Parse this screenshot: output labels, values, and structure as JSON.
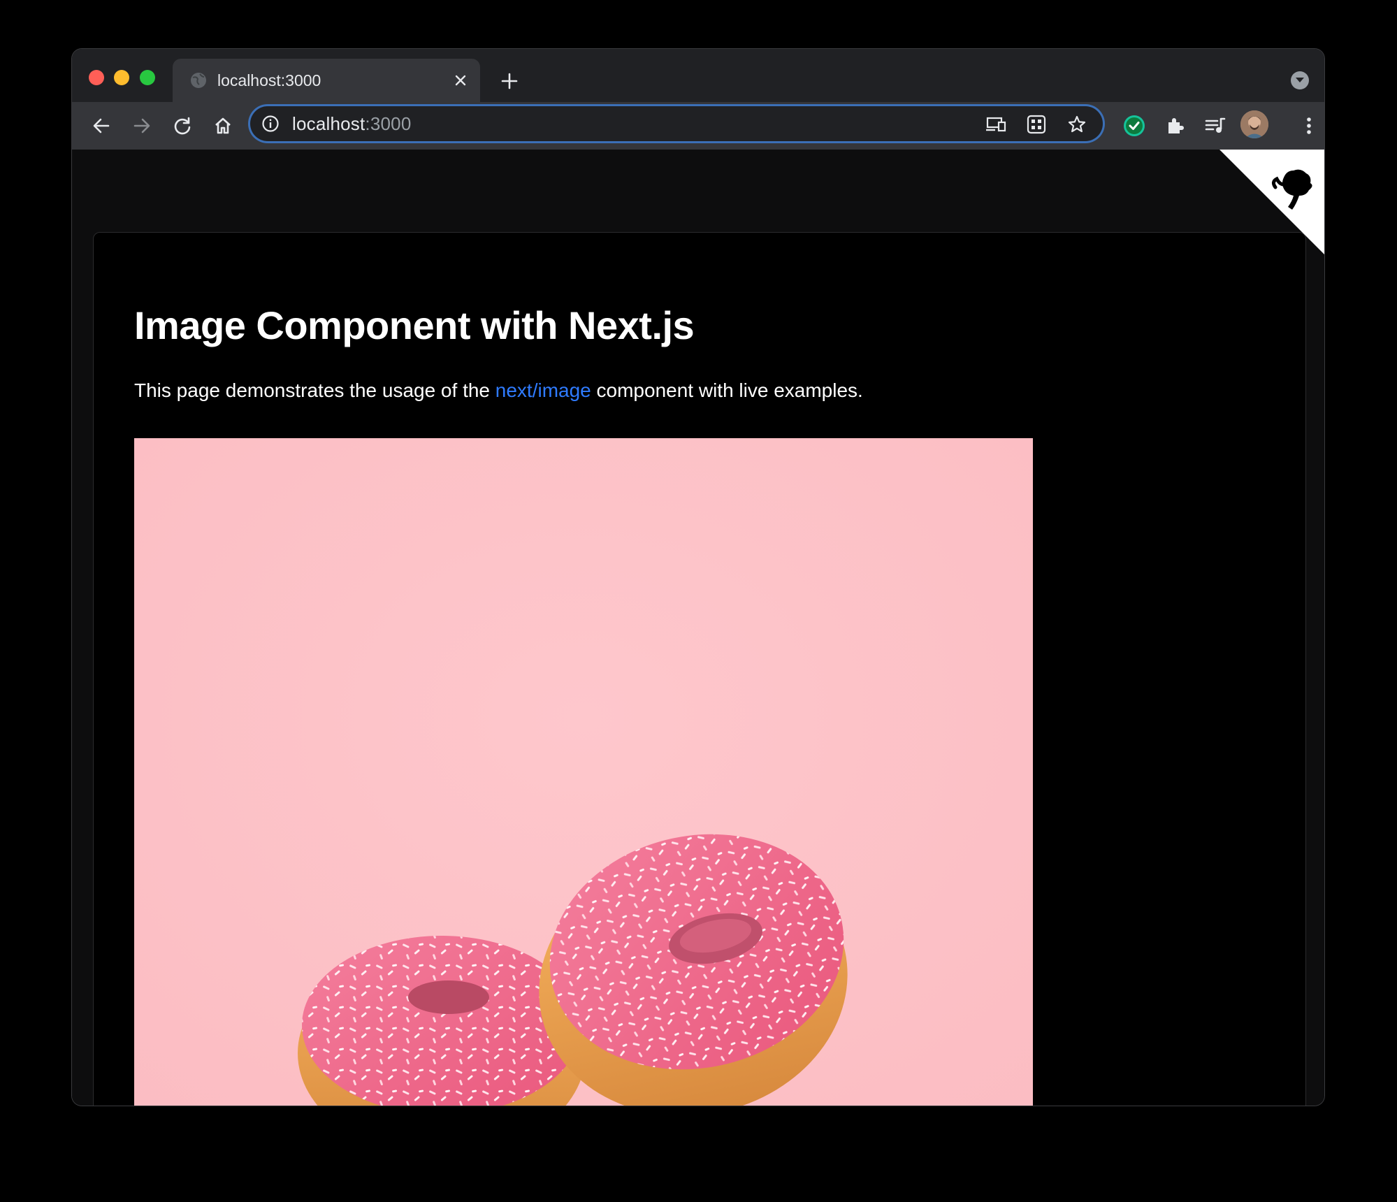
{
  "browser": {
    "tab": {
      "title": "localhost:3000",
      "close_label": "×"
    },
    "new_tab_label": "+",
    "address": {
      "host": "localhost",
      "port": ":3000"
    }
  },
  "page": {
    "title": "Image Component with Next.js",
    "description_before": "This page demonstrates the usage of the ",
    "description_link": "next/image",
    "description_after": " component with live examples."
  },
  "image": {
    "subject": "two pink sprinkled donuts on pink background"
  },
  "colors": {
    "page_background": "#000000",
    "link": "#2f7bff",
    "photo_background": "#fdc2c8",
    "donut_frosting": "#f0708f",
    "donut_dough": "#e9a150"
  }
}
